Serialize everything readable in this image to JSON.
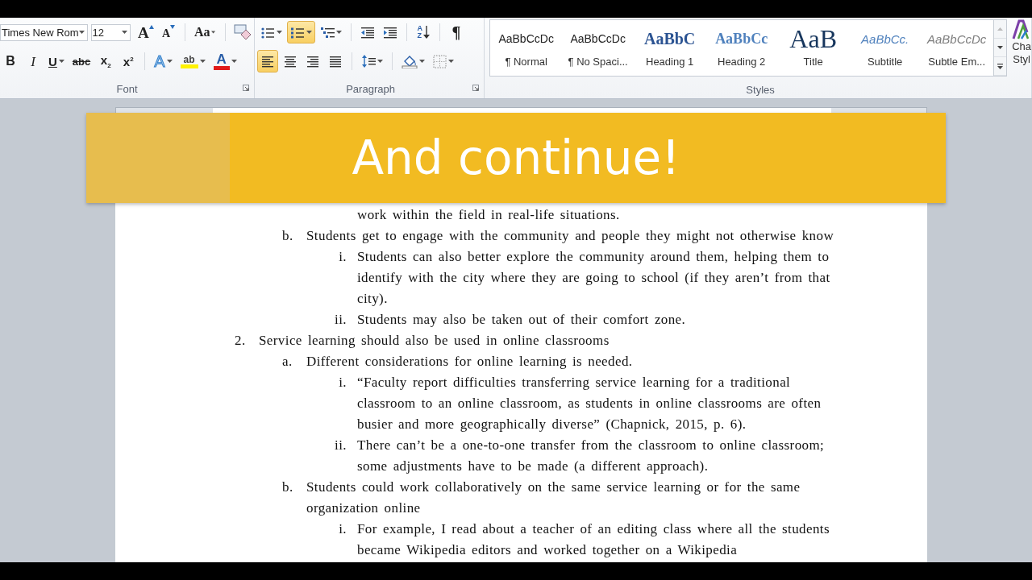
{
  "ribbon": {
    "font": {
      "label": "Font",
      "font_name": "Times New Rom",
      "font_size": "12",
      "row1": [
        {
          "kind": "grow-font",
          "label": "A",
          "dropdown": false,
          "selected": false
        },
        {
          "kind": "shrink-font",
          "label": "A",
          "dropdown": false,
          "selected": false
        },
        {
          "kind": "change-case",
          "label": "Aa",
          "dropdown": true,
          "selected": false
        },
        {
          "kind": "clear-format",
          "dropdown": false,
          "selected": false
        }
      ],
      "row2": [
        {
          "kind": "bold",
          "label": "B",
          "dropdown": false,
          "selected": false
        },
        {
          "kind": "italic",
          "label": "I",
          "dropdown": false,
          "selected": false
        },
        {
          "kind": "underline",
          "label": "U",
          "dropdown": true,
          "selected": false
        },
        {
          "kind": "strikethrough",
          "label": "abc",
          "dropdown": false,
          "selected": false
        },
        {
          "kind": "subscript",
          "label": "x$_{2}$",
          "dropdown": false,
          "selected": false
        },
        {
          "kind": "superscript",
          "label": "x$^{2}$",
          "dropdown": false,
          "selected": false
        },
        {
          "kind": "text-effects",
          "label": "A",
          "dropdown": true,
          "selected": false
        },
        {
          "kind": "highlight",
          "label": "ab",
          "dropdown": true,
          "selected": false
        },
        {
          "kind": "font-color",
          "label": "A",
          "dropdown": true,
          "selected": false
        }
      ]
    },
    "paragraph": {
      "label": "Paragraph",
      "row1": [
        {
          "kind": "bullets",
          "dropdown": true,
          "selected": false
        },
        {
          "kind": "numbering",
          "dropdown": true,
          "selected": true
        },
        {
          "kind": "multilevel",
          "dropdown": true,
          "selected": false
        },
        {
          "kind": "decrease-indent",
          "dropdown": false,
          "selected": false
        },
        {
          "kind": "increase-indent",
          "dropdown": false,
          "selected": false
        },
        {
          "kind": "sort",
          "label": "AZ",
          "dropdown": false,
          "selected": false
        },
        {
          "kind": "show-marks",
          "label": "¶",
          "dropdown": false,
          "selected": false
        }
      ],
      "row2": [
        {
          "kind": "align-left",
          "dropdown": false,
          "selected": true
        },
        {
          "kind": "align-center",
          "dropdown": false,
          "selected": false
        },
        {
          "kind": "align-right",
          "dropdown": false,
          "selected": false
        },
        {
          "kind": "justify",
          "dropdown": false,
          "selected": false
        },
        {
          "kind": "line-spacing",
          "dropdown": true,
          "selected": false
        },
        {
          "kind": "shading",
          "dropdown": true,
          "selected": false
        },
        {
          "kind": "borders",
          "dropdown": true,
          "selected": false
        }
      ]
    },
    "styles": {
      "label": "Styles",
      "items": [
        {
          "kind": "normal",
          "preview": "AaBbCcDc",
          "name": "¶ Normal"
        },
        {
          "kind": "normal",
          "preview": "AaBbCcDc",
          "name": "¶ No Spaci..."
        },
        {
          "kind": "heading1",
          "preview": "AaBbC",
          "name": "Heading 1"
        },
        {
          "kind": "heading2",
          "preview": "AaBbCc",
          "name": "Heading 2"
        },
        {
          "kind": "title",
          "preview": "AaB",
          "name": "Title"
        },
        {
          "kind": "subtitle",
          "preview": "AaBbCc.",
          "name": "Subtitle"
        },
        {
          "kind": "subtle",
          "preview": "AaBbCcDc",
          "name": "Subtle Em..."
        }
      ],
      "change_styles": {
        "label_lines": [
          "Cha",
          "Styl"
        ]
      }
    }
  },
  "document": {
    "outline": [
      {
        "children": [
          {
            "children": [
              {
                "text": "work within the field in real-life situations."
              }
            ]
          },
          {
            "marker": "b.",
            "text": "Students get to engage with the community and people they might not otherwise know",
            "children": [
              {
                "marker": "i.",
                "text": "Students can also better explore the community around them, helping them to identify with the city where they are going to school (if they aren’t from that city)."
              },
              {
                "marker": "ii.",
                "text": "Students may also be taken out of their comfort zone."
              }
            ]
          }
        ]
      },
      {
        "marker": "2.",
        "text": "Service learning should also be used in online classrooms",
        "children": [
          {
            "marker": "a.",
            "text": "Different considerations for online learning is needed.",
            "children": [
              {
                "marker": "i.",
                "text": "“Faculty report difficulties transferring service learning for a traditional classroom to an online classroom, as students in online classrooms are often busier and more geographically diverse” (Chapnick, 2015, p. 6)."
              },
              {
                "marker": "ii.",
                "text": "There can’t be a one-to-one transfer from the classroom to online classroom; some adjustments have to be made (a different approach)."
              }
            ]
          },
          {
            "marker": "b.",
            "text": "Students could work collaboratively on the same service learning or for the same organization online",
            "children": [
              {
                "marker": "i.",
                "text": "For example, I read about a teacher of an editing class where all the students became Wikipedia editors and worked together on a Wikipedia"
              }
            ]
          }
        ]
      }
    ]
  },
  "overlay_banner": {
    "text": "And continue!"
  }
}
